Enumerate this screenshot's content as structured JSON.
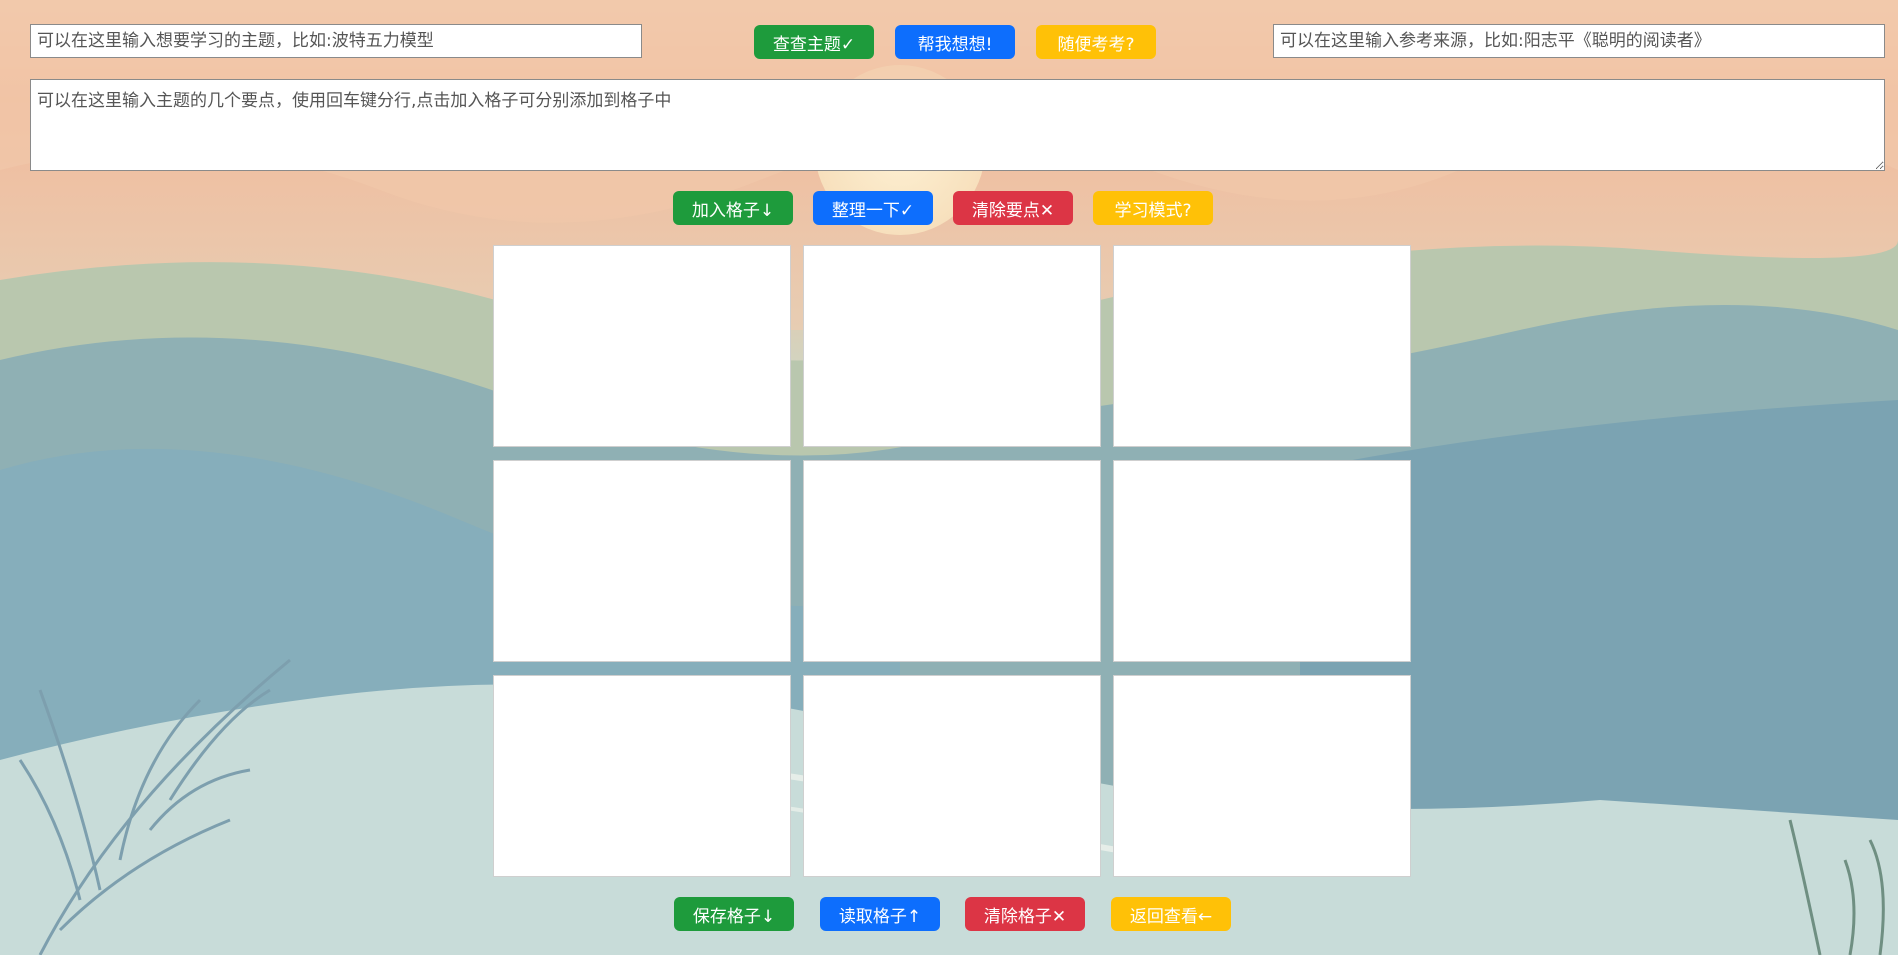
{
  "topic": {
    "placeholder": "可以在这里输入想要学习的主题，比如:波特五力模型"
  },
  "buttons_top": {
    "check_topic": "查查主题✓",
    "help_think": "帮我想想!",
    "random_quiz": "随便考考?"
  },
  "source": {
    "placeholder": "可以在这里输入参考来源，比如:阳志平《聪明的阅读者》"
  },
  "points": {
    "placeholder": "可以在这里输入主题的几个要点，使用回车键分行,点击加入格子可分别添加到格子中"
  },
  "buttons_middle": {
    "add_to_grid": "加入格子↓",
    "organize": "整理一下✓",
    "clear_points": "清除要点✕",
    "study_mode": "学习模式?"
  },
  "grid": {
    "cells": [
      "",
      "",
      "",
      "",
      "",
      "",
      "",
      "",
      ""
    ]
  },
  "buttons_bottom": {
    "save_grid": "保存格子↓",
    "load_grid": "读取格子↑",
    "clear_grid": "清除格子✕",
    "back_view": "返回查看←"
  },
  "colors": {
    "green": "#1e9b3c",
    "blue": "#0d6efd",
    "red": "#dc3545",
    "yellow": "#ffc107"
  }
}
